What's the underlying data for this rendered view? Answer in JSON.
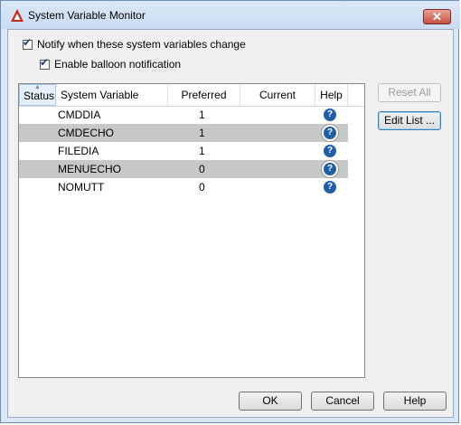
{
  "window": {
    "title": "System Variable Monitor",
    "close_glyph": "✕"
  },
  "options": {
    "notify": {
      "label": "Notify when these system variables change",
      "checked": true
    },
    "balloon": {
      "label": "Enable balloon notification",
      "checked": true
    }
  },
  "table": {
    "columns": [
      "Status",
      "System Variable",
      "Preferred",
      "Current",
      "Help"
    ],
    "rows": [
      {
        "variable": "CMDDIA",
        "preferred": "1",
        "current": ""
      },
      {
        "variable": "CMDECHO",
        "preferred": "1",
        "current": ""
      },
      {
        "variable": "FILEDIA",
        "preferred": "1",
        "current": ""
      },
      {
        "variable": "MENUECHO",
        "preferred": "0",
        "current": ""
      },
      {
        "variable": "NOMUTT",
        "preferred": "0",
        "current": ""
      }
    ],
    "help_glyph": "?"
  },
  "side_buttons": {
    "reset_all": "Reset All",
    "edit_list": "Edit List ..."
  },
  "footer": {
    "ok": "OK",
    "cancel": "Cancel",
    "help": "Help"
  },
  "colors": {
    "title_bar": "#d2e2f4",
    "close_button": "#c7513f",
    "alt_row": "#c8c8c8",
    "help_icon": "#1f5fa8"
  }
}
